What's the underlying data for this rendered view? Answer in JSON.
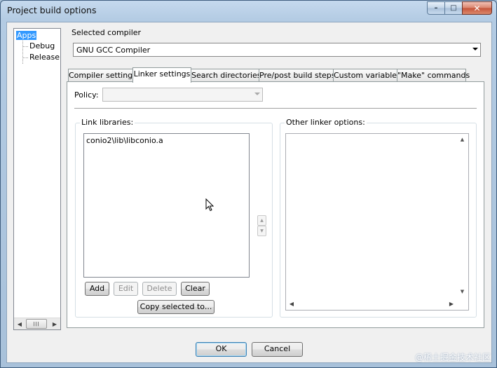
{
  "window": {
    "title": "Project build options"
  },
  "tree": {
    "items": [
      {
        "label": "Apps",
        "selected": true
      },
      {
        "label": "Debug"
      },
      {
        "label": "Release"
      }
    ],
    "scroll_thumb_glyph": "|||"
  },
  "compiler": {
    "label": "Selected compiler",
    "value": "GNU GCC Compiler"
  },
  "tabs": [
    {
      "label": "Compiler settings"
    },
    {
      "label": "Linker settings",
      "active": true
    },
    {
      "label": "Search directories"
    },
    {
      "label": "Pre/post build steps"
    },
    {
      "label": "Custom variables"
    },
    {
      "label": "\"Make\" commands"
    }
  ],
  "linker": {
    "policy_label": "Policy:",
    "policy_value": "",
    "link_libraries": {
      "title": "Link libraries:",
      "items": [
        "conio2\\lib\\libconio.a"
      ],
      "buttons": {
        "add": "Add",
        "edit": "Edit",
        "delete": "Delete",
        "clear": "Clear",
        "copy": "Copy selected to..."
      }
    },
    "other_options": {
      "title": "Other linker options:",
      "value": ""
    }
  },
  "footer": {
    "ok": "OK",
    "cancel": "Cancel"
  },
  "watermark": "@稀土掘金技术社区"
}
